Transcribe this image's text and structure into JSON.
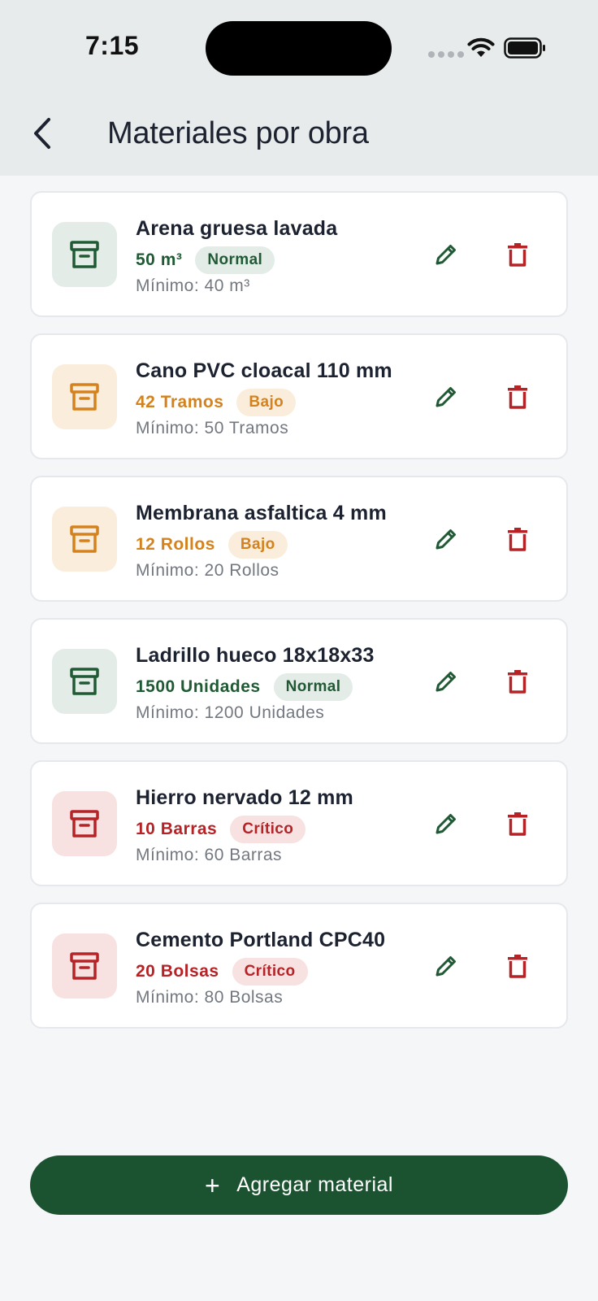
{
  "status_bar": {
    "time": "7:15"
  },
  "header": {
    "title": "Materiales por obra"
  },
  "materials": [
    {
      "name": "Arena gruesa lavada",
      "quantity": "50 m³",
      "status": "Normal",
      "minimum": "Mínimo: 40 m³"
    },
    {
      "name": "Cano PVC cloacal 110 mm",
      "quantity": "42 Tramos",
      "status": "Bajo",
      "minimum": "Mínimo: 50 Tramos"
    },
    {
      "name": "Membrana asfaltica 4 mm",
      "quantity": "12 Rollos",
      "status": "Bajo",
      "minimum": "Mínimo: 20 Rollos"
    },
    {
      "name": "Ladrillo hueco 18x18x33",
      "quantity": "1500 Unidades",
      "status": "Normal",
      "minimum": "Mínimo: 1200 Unidades"
    },
    {
      "name": "Hierro nervado 12 mm",
      "quantity": "10 Barras",
      "status": "Crítico",
      "minimum": "Mínimo: 60 Barras"
    },
    {
      "name": "Cemento Portland CPC40",
      "quantity": "20 Bolsas",
      "status": "Crítico",
      "minimum": "Mínimo: 80 Bolsas"
    }
  ],
  "add_button": {
    "label": "Agregar material",
    "icon": "plus-icon"
  },
  "colors": {
    "normal": "#1f5a34",
    "bajo": "#d4821d",
    "critico": "#b52327",
    "primary": "#1b5331",
    "edit": "#1f5a34",
    "delete": "#b52327"
  }
}
